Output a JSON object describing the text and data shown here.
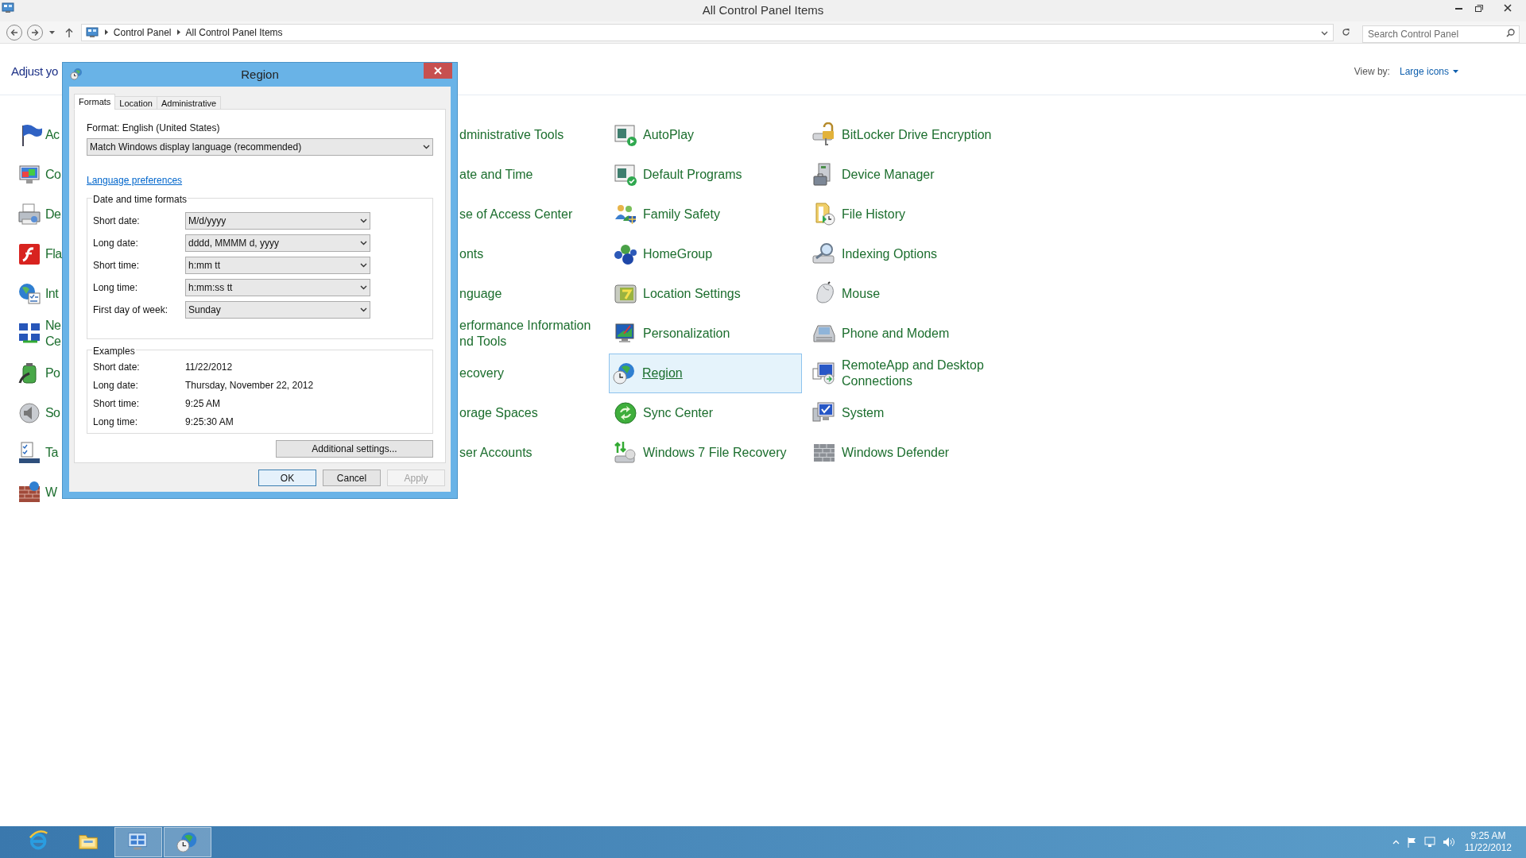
{
  "window": {
    "title": "All Control Panel Items"
  },
  "address_bar": {
    "breadcrumbs": [
      "Control Panel",
      "All Control Panel Items"
    ]
  },
  "search": {
    "placeholder": "Search Control Panel"
  },
  "header": {
    "heading": "Adjust yo",
    "view_by_label": "View by:",
    "view_by_value": "Large icons"
  },
  "columns": [
    [
      {
        "label": "Ac",
        "selected": false
      },
      {
        "label": "Co",
        "selected": false
      },
      {
        "label": "De",
        "selected": false
      },
      {
        "label": "Fla",
        "selected": false
      },
      {
        "label": "Int",
        "selected": false
      },
      {
        "label": "Ne\nCe",
        "selected": false
      },
      {
        "label": "Po",
        "selected": false
      },
      {
        "label": "So",
        "selected": false
      },
      {
        "label": "Ta",
        "selected": false
      },
      {
        "label": "W",
        "selected": false
      }
    ],
    [],
    [
      {
        "label": "dministrative Tools",
        "selected": false
      },
      {
        "label": "ate and Time",
        "selected": false
      },
      {
        "label": "se of Access Center",
        "selected": false
      },
      {
        "label": "onts",
        "selected": false
      },
      {
        "label": "nguage",
        "selected": false
      },
      {
        "label": "erformance Information\nnd Tools",
        "selected": false
      },
      {
        "label": "ecovery",
        "selected": false
      },
      {
        "label": "orage Spaces",
        "selected": false
      },
      {
        "label": "ser Accounts",
        "selected": false
      }
    ],
    [
      {
        "label": "AutoPlay",
        "selected": false
      },
      {
        "label": "Default Programs",
        "selected": false
      },
      {
        "label": "Family Safety",
        "selected": false
      },
      {
        "label": "HomeGroup",
        "selected": false
      },
      {
        "label": "Location Settings",
        "selected": false
      },
      {
        "label": "Personalization",
        "selected": false
      },
      {
        "label": "Region",
        "selected": true
      },
      {
        "label": "Sync Center",
        "selected": false
      },
      {
        "label": "Windows 7 File Recovery",
        "selected": false
      }
    ],
    [
      {
        "label": "BitLocker Drive Encryption",
        "selected": false
      },
      {
        "label": "Device Manager",
        "selected": false
      },
      {
        "label": "File History",
        "selected": false
      },
      {
        "label": "Indexing Options",
        "selected": false
      },
      {
        "label": "Mouse",
        "selected": false
      },
      {
        "label": "Phone and Modem",
        "selected": false
      },
      {
        "label": "RemoteApp and Desktop\nConnections",
        "selected": false
      },
      {
        "label": "System",
        "selected": false
      },
      {
        "label": "Windows Defender",
        "selected": false
      }
    ]
  ],
  "dialog": {
    "title": "Region",
    "tabs": [
      {
        "label": "Formats",
        "selected": true
      },
      {
        "label": "Location",
        "selected": false
      },
      {
        "label": "Administrative",
        "selected": false
      }
    ],
    "format_label": "Format: English (United States)",
    "format_value": "Match Windows display language (recommended)",
    "link": "Language preferences",
    "formats_group": {
      "title": "Date and time formats",
      "fields": [
        {
          "label": "Short date:",
          "value": "M/d/yyyy"
        },
        {
          "label": "Long date:",
          "value": "dddd, MMMM d, yyyy"
        },
        {
          "label": "Short time:",
          "value": "h:mm tt"
        },
        {
          "label": "Long time:",
          "value": "h:mm:ss tt"
        },
        {
          "label": "First day of week:",
          "value": "Sunday"
        }
      ]
    },
    "examples_group": {
      "title": "Examples",
      "rows": [
        {
          "label": "Short date:",
          "value": "11/22/2012"
        },
        {
          "label": "Long date:",
          "value": "Thursday, November 22, 2012"
        },
        {
          "label": "Short time:",
          "value": "9:25 AM"
        },
        {
          "label": "Long time:",
          "value": "9:25:30 AM"
        }
      ]
    },
    "additional_button": "Additional settings...",
    "buttons": [
      {
        "label": "OK",
        "default": true,
        "disabled": false
      },
      {
        "label": "Cancel",
        "default": false,
        "disabled": false
      },
      {
        "label": "Apply",
        "default": false,
        "disabled": true
      }
    ]
  },
  "taskbar": {
    "apps": [
      {
        "kind": "browser",
        "selected": false
      },
      {
        "kind": "explorer",
        "selected": false
      },
      {
        "kind": "control-panel",
        "selected": true
      },
      {
        "kind": "region",
        "selected": true
      }
    ],
    "clock": {
      "time": "9:25 AM",
      "date": "11/22/2012"
    }
  }
}
